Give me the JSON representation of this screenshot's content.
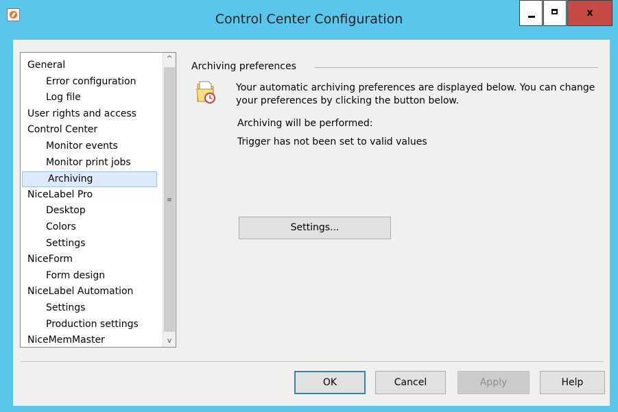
{
  "window": {
    "title": "Control Center Configuration",
    "close_label": "x",
    "accent_color": "#5bc6ec"
  },
  "tree": {
    "items": [
      {
        "label": "General",
        "level": 0,
        "selected": false
      },
      {
        "label": "Error configuration",
        "level": 1,
        "selected": false
      },
      {
        "label": "Log file",
        "level": 1,
        "selected": false
      },
      {
        "label": "User rights and access",
        "level": 0,
        "selected": false
      },
      {
        "label": "Control Center",
        "level": 0,
        "selected": false
      },
      {
        "label": "Monitor events",
        "level": 1,
        "selected": false
      },
      {
        "label": "Monitor print jobs",
        "level": 1,
        "selected": false
      },
      {
        "label": "Archiving",
        "level": 1,
        "selected": true
      },
      {
        "label": "NiceLabel Pro",
        "level": 0,
        "selected": false
      },
      {
        "label": "Desktop",
        "level": 1,
        "selected": false
      },
      {
        "label": "Colors",
        "level": 1,
        "selected": false
      },
      {
        "label": "Settings",
        "level": 1,
        "selected": false
      },
      {
        "label": "NiceForm",
        "level": 0,
        "selected": false
      },
      {
        "label": "Form design",
        "level": 1,
        "selected": false
      },
      {
        "label": "NiceLabel Automation",
        "level": 0,
        "selected": false
      },
      {
        "label": "Settings",
        "level": 1,
        "selected": false
      },
      {
        "label": "Production settings",
        "level": 1,
        "selected": false
      },
      {
        "label": "NiceMemMaster",
        "level": 0,
        "selected": false
      }
    ],
    "scroll_up_icon": "chevron-up-icon",
    "scroll_down_icon": "chevron-down-icon",
    "scroll_up_glyph": "^",
    "scroll_down_glyph": "v",
    "scroll_grip_glyph": "≡"
  },
  "panel": {
    "group_title": "Archiving preferences",
    "icon": "folder-clock-icon",
    "description": "Your automatic archiving preferences are displayed below. You can change your preferences by clicking the button below.",
    "status_heading": "Archiving will be performed:",
    "status_value": "Trigger has not been set to valid values",
    "settings_button": "Settings..."
  },
  "buttons": {
    "ok": "OK",
    "cancel": "Cancel",
    "apply": "Apply",
    "help": "Help"
  }
}
